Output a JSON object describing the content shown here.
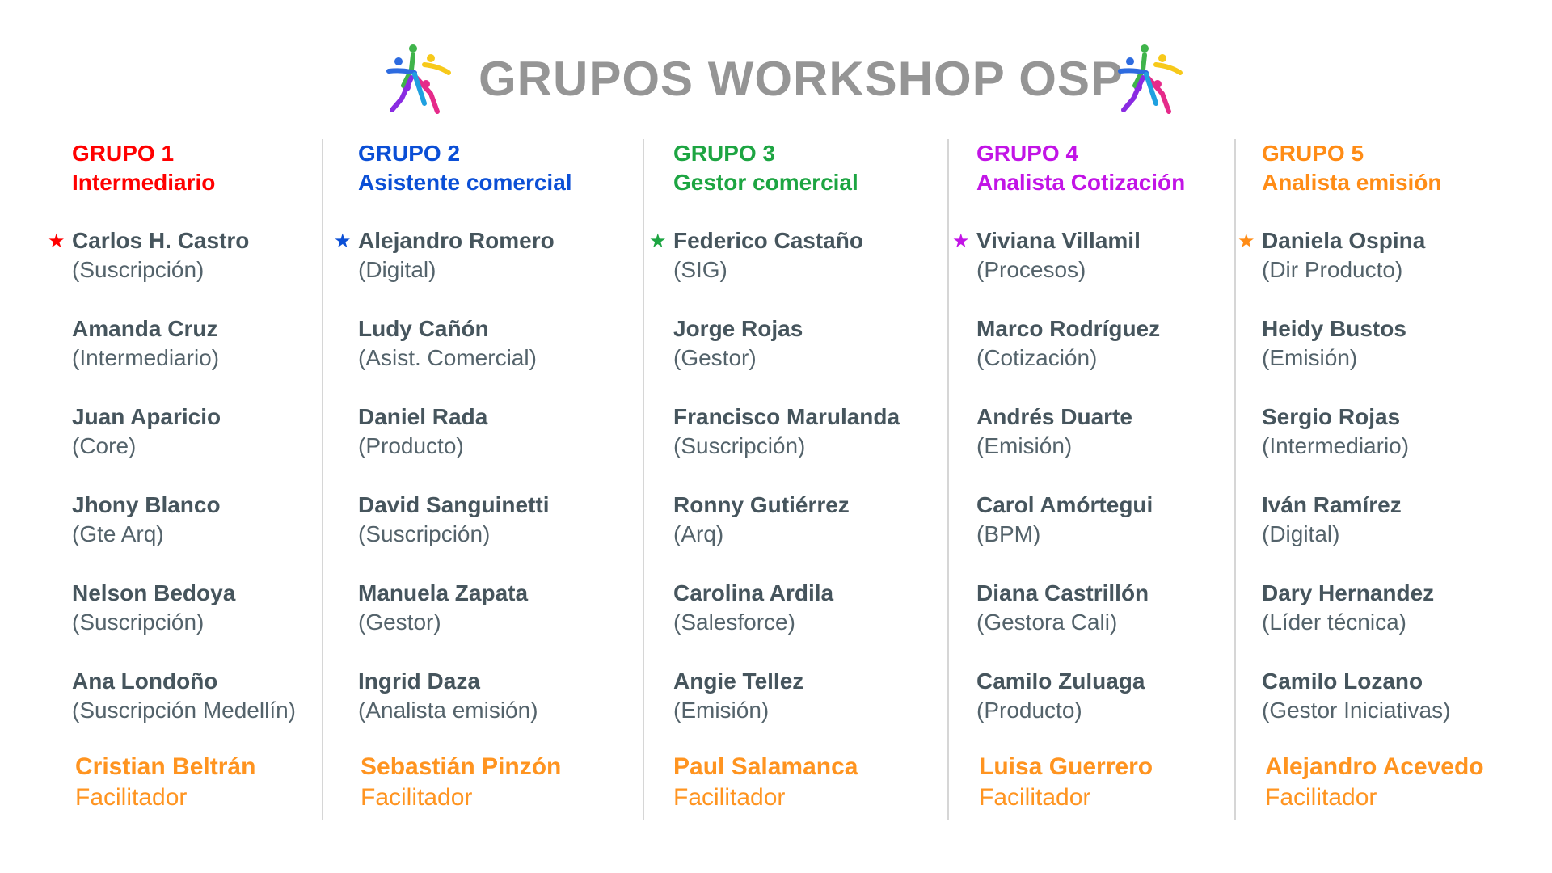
{
  "title": "GRUPOS WORKSHOP OSP",
  "logo_icon": "star-people-icon",
  "facilitator_color": "#FF9420",
  "groups": [
    {
      "number": "GRUPO 1",
      "role": "Intermediario",
      "color": "#FF0000",
      "members": [
        {
          "name": "Carlos H. Castro",
          "area": "(Suscripción)"
        },
        {
          "name": "Amanda Cruz",
          "area": "(Intermediario)"
        },
        {
          "name": "Juan Aparicio",
          "area": "(Core)"
        },
        {
          "name": "Jhony Blanco",
          "area": "(Gte Arq)"
        },
        {
          "name": "Nelson Bedoya",
          "area": "(Suscripción)"
        },
        {
          "name": "Ana Londoño",
          "area": "(Suscripción Medellín)"
        }
      ],
      "facilitator": {
        "name": "Cristian Beltrán",
        "label": "Facilitador"
      }
    },
    {
      "number": "GRUPO 2",
      "role": "Asistente comercial",
      "color": "#0B4FD6",
      "members": [
        {
          "name": "Alejandro Romero",
          "area": "(Digital)"
        },
        {
          "name": "Ludy Cañón",
          "area": "(Asist. Comercial)"
        },
        {
          "name": "Daniel Rada",
          "area": "(Producto)"
        },
        {
          "name": "David Sanguinetti",
          "area": "(Suscripción)"
        },
        {
          "name": "Manuela Zapata",
          "area": "(Gestor)"
        },
        {
          "name": "Ingrid Daza",
          "area": "(Analista emisión)"
        }
      ],
      "facilitator": {
        "name": "Sebastián Pinzón",
        "label": "Facilitador"
      }
    },
    {
      "number": "GRUPO 3",
      "role": "Gestor comercial",
      "color": "#1DA542",
      "members": [
        {
          "name": "Federico Castaño",
          "area": "(SIG)"
        },
        {
          "name": "Jorge Rojas",
          "area": "(Gestor)"
        },
        {
          "name": "Francisco Marulanda",
          "area": "(Suscripción)"
        },
        {
          "name": "Ronny Gutiérrez",
          "area": "(Arq)"
        },
        {
          "name": "Carolina Ardila",
          "area": "(Salesforce)"
        },
        {
          "name": "Angie Tellez",
          "area": "(Emisión)"
        }
      ],
      "facilitator": {
        "name": "Paul Salamanca",
        "label": "Facilitador"
      }
    },
    {
      "number": "GRUPO 4",
      "role": "Analista Cotización",
      "color": "#C214E6",
      "members": [
        {
          "name": "Viviana Villamil",
          "area": "(Procesos)"
        },
        {
          "name": "Marco Rodríguez",
          "area": "(Cotización)"
        },
        {
          "name": "Andrés Duarte",
          "area": "(Emisión)"
        },
        {
          "name": "Carol Amórtegui",
          "area": "(BPM)"
        },
        {
          "name": "Diana Castrillón",
          "area": "(Gestora Cali)"
        },
        {
          "name": "Camilo Zuluaga",
          "area": "(Producto)"
        }
      ],
      "facilitator": {
        "name": "Luisa Guerrero",
        "label": "Facilitador"
      }
    },
    {
      "number": "GRUPO 5",
      "role": "Analista emisión",
      "color": "#FF8C16",
      "members": [
        {
          "name": "Daniela Ospina",
          "area": "(Dir Producto)"
        },
        {
          "name": "Heidy Bustos",
          "area": "(Emisión)"
        },
        {
          "name": "Sergio Rojas",
          "area": "(Intermediario)"
        },
        {
          "name": "Iván Ramírez",
          "area": "(Digital)"
        },
        {
          "name": "Dary Hernandez",
          "area": "(Líder técnica)"
        },
        {
          "name": "Camilo Lozano",
          "area": "(Gestor Iniciativas)"
        }
      ],
      "facilitator": {
        "name": "Alejandro Acevedo",
        "label": "Facilitador"
      }
    }
  ]
}
